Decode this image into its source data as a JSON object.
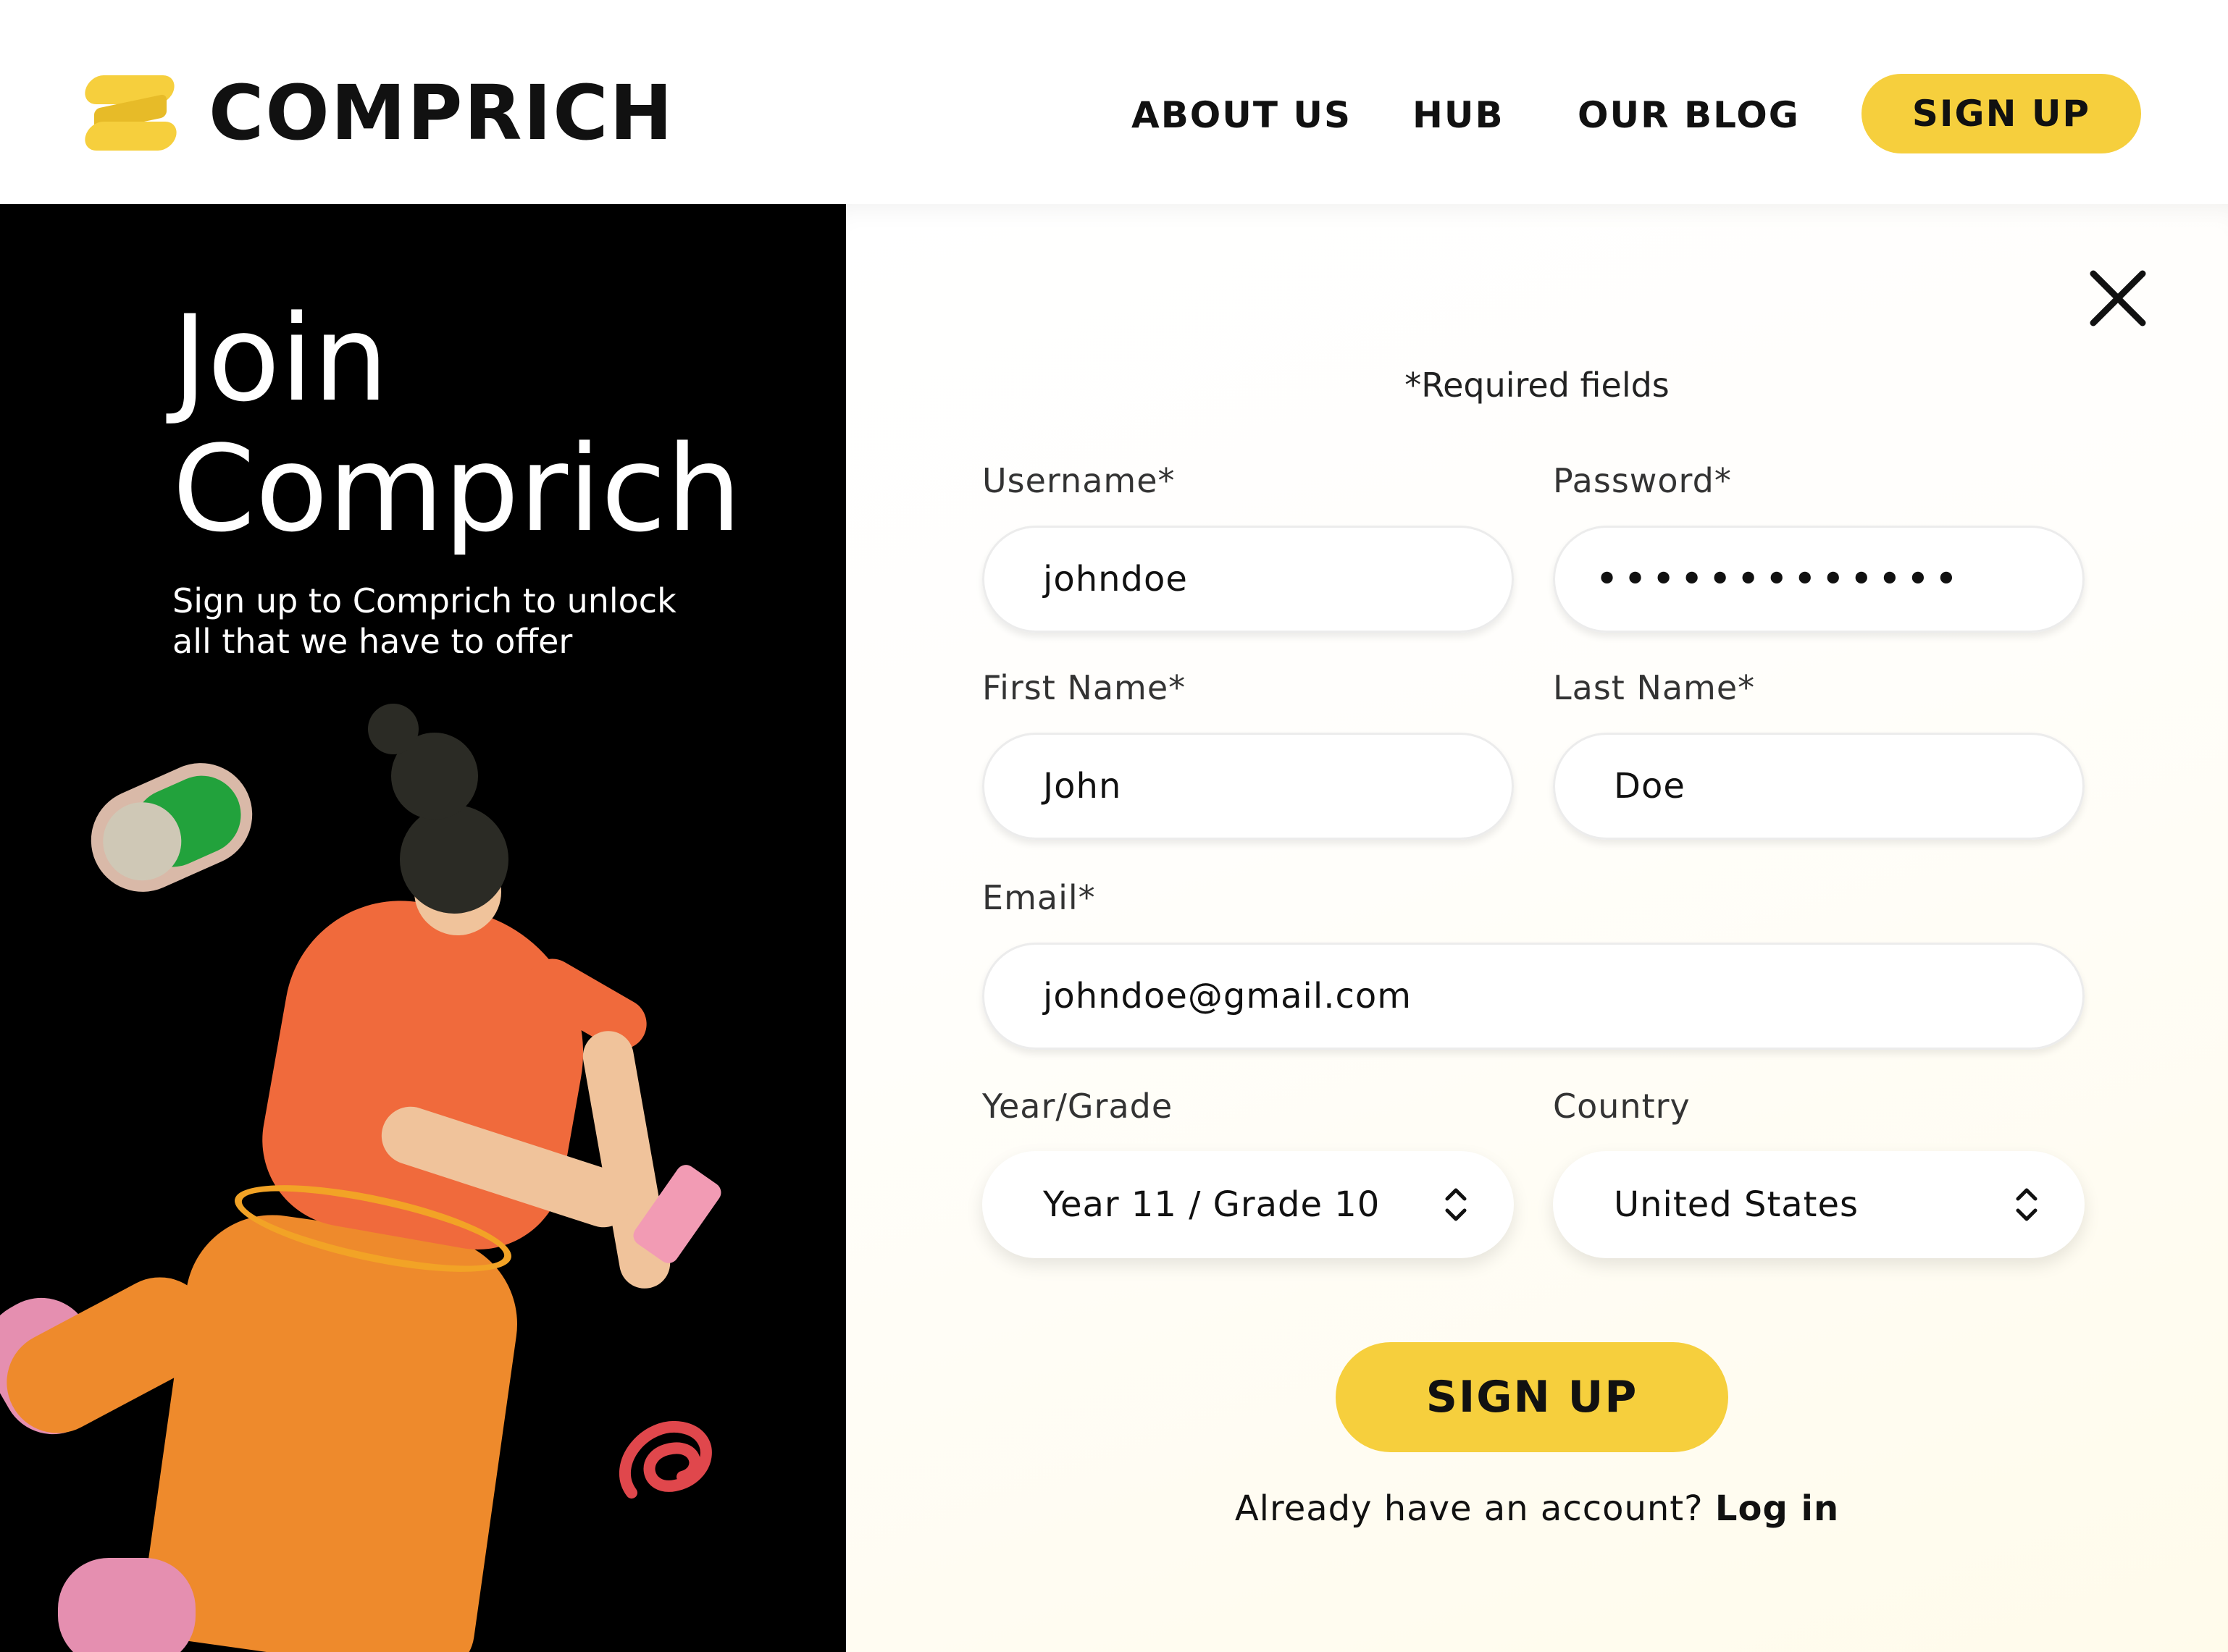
{
  "header": {
    "brand": "COMPRICH",
    "nav": [
      "ABOUT US",
      "HUB",
      "OUR BLOG"
    ],
    "signup_label": "SIGN UP"
  },
  "hero": {
    "title_line1": "Join",
    "title_line2": "Comprich",
    "subtitle_line1": "Sign up to Comprich to unlock",
    "subtitle_line2": "all that we have to offer"
  },
  "form": {
    "required_note": "*Required fields",
    "username": {
      "label": "Username*",
      "value": "johndoe"
    },
    "password": {
      "label": "Password*",
      "value": "•••••••••••••"
    },
    "first_name": {
      "label": "First Name*",
      "value": "John"
    },
    "last_name": {
      "label": "Last Name*",
      "value": "Doe"
    },
    "email": {
      "label": "Email*",
      "value": "johndoe@gmail.com"
    },
    "year_grade": {
      "label": "Year/Grade",
      "value": "Year 11 / Grade 10"
    },
    "country": {
      "label": "Country",
      "value": "United States"
    },
    "submit_label": "SIGN UP",
    "login_prompt": "Already have an account?",
    "login_link": "Log in"
  },
  "colors": {
    "accent": "#f6cf3d",
    "left_panel": "#000000",
    "text": "#111111"
  },
  "icons": {
    "close": "close-icon",
    "select": "chevron-up-down-icon",
    "logo": "comprich-logo-icon"
  }
}
